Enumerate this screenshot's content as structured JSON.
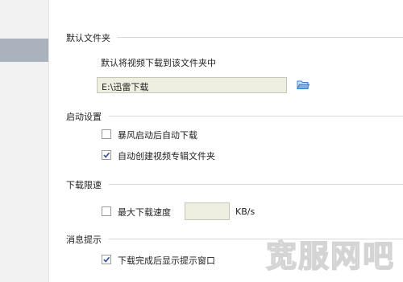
{
  "sections": {
    "default_folder": {
      "title": "默认文件夹",
      "description": "默认将视频下载到该文件夹中",
      "path_value": "E:\\迅雷下载",
      "folder_icon": "folder-open-icon"
    },
    "startup": {
      "title": "启动设置",
      "options": [
        {
          "label": "暴风启动后自动下载",
          "checked": false
        },
        {
          "label": "自动创建视频专辑文件夹",
          "checked": true
        }
      ]
    },
    "speed_limit": {
      "title": "下载限速",
      "max_speed_label": "最大下载速度",
      "max_speed_checked": false,
      "speed_value": "",
      "unit": "KB/s"
    },
    "notification": {
      "title": "消息提示",
      "options": [
        {
          "label": "下载完成后显示提示窗口",
          "checked": true
        }
      ]
    }
  },
  "watermark_text": "宽服网吧",
  "colors": {
    "sidebar_selected": "#aab2bd",
    "input_background": "#efefe1",
    "folder_icon": "#3a7bc8",
    "checkmark": "#2a4f9b"
  }
}
